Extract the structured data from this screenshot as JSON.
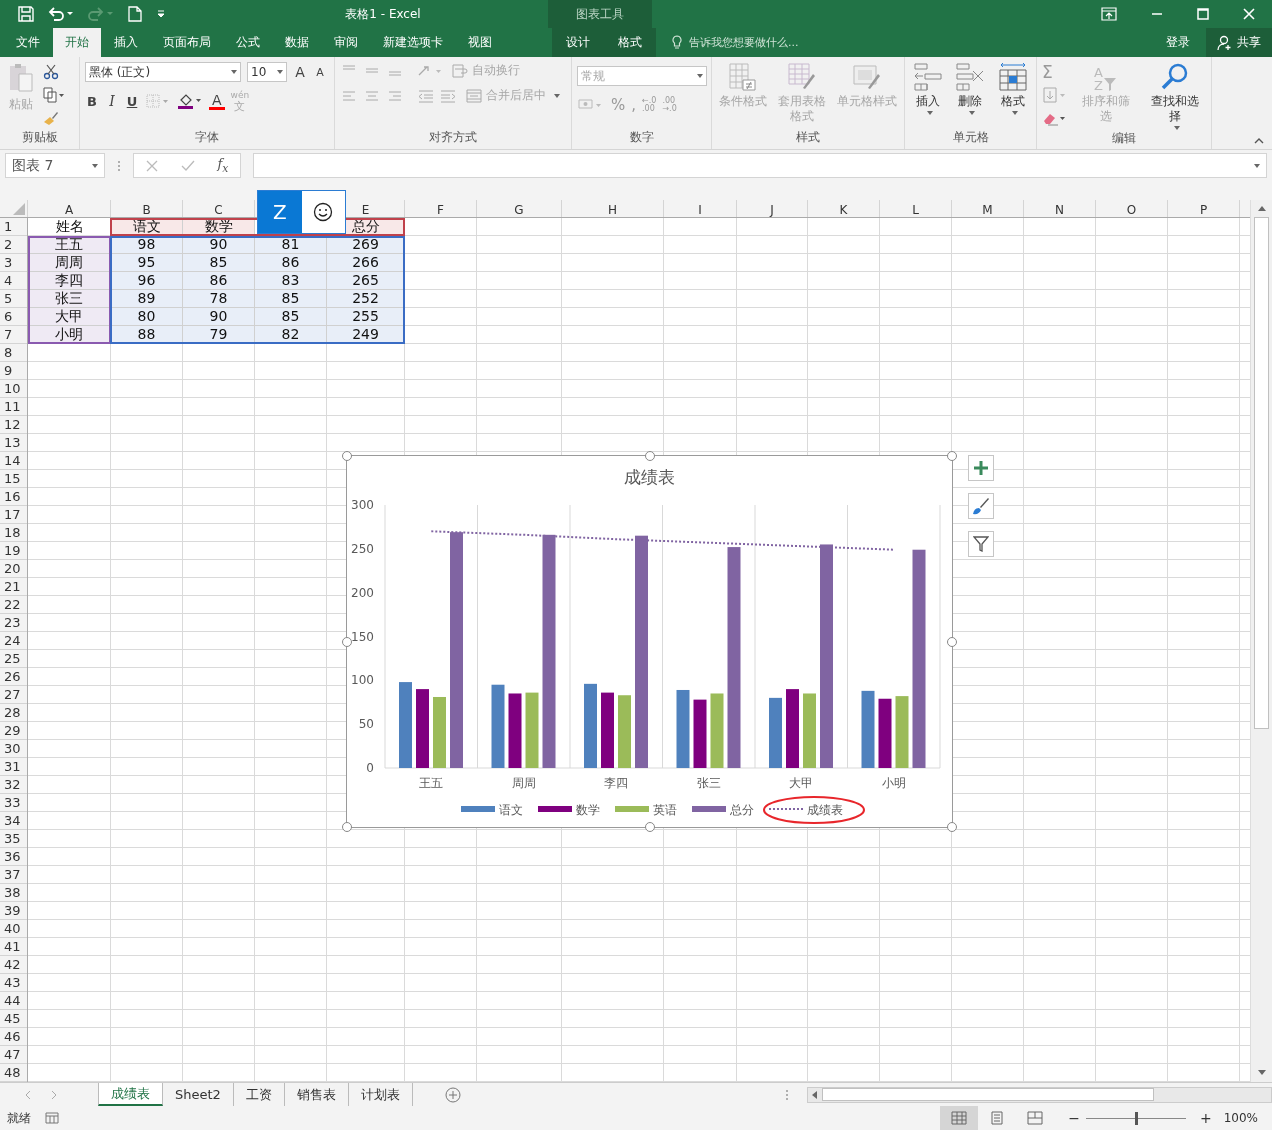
{
  "title_bar": {
    "title": "表格1 - Excel",
    "context_title": "图表工具"
  },
  "menu_tabs": [
    {
      "label": "文件",
      "selected": false,
      "context": false
    },
    {
      "label": "开始",
      "selected": true,
      "context": false
    },
    {
      "label": "插入",
      "selected": false,
      "context": false
    },
    {
      "label": "页面布局",
      "selected": false,
      "context": false
    },
    {
      "label": "公式",
      "selected": false,
      "context": false
    },
    {
      "label": "数据",
      "selected": false,
      "context": false
    },
    {
      "label": "审阅",
      "selected": false,
      "context": false
    },
    {
      "label": "新建选项卡",
      "selected": false,
      "context": false
    },
    {
      "label": "视图",
      "selected": false,
      "context": false
    },
    {
      "label": "设计",
      "selected": false,
      "context": true
    },
    {
      "label": "格式",
      "selected": false,
      "context": true
    }
  ],
  "tell_me": {
    "placeholder": "告诉我您想要做什么..."
  },
  "account": {
    "sign_in": "登录",
    "share": "共享"
  },
  "ribbon": {
    "clipboard": {
      "label": "剪贴板",
      "paste": {
        "label": "粘贴",
        "disabled": true
      }
    },
    "font": {
      "label": "字体",
      "font_name": "黑体 (正文)",
      "font_size": "10",
      "grow": "A",
      "shrink": "A",
      "bold": "B",
      "italic": "I",
      "underline": "U",
      "font_color": "A",
      "phonetic_top": "wén",
      "phonetic_bottom": "文"
    },
    "alignment": {
      "label": "对齐方式",
      "wrap_text": {
        "label": "自动换行",
        "disabled": true
      },
      "merge": {
        "label": "合并后居中",
        "disabled": true
      }
    },
    "number": {
      "label": "数字",
      "format": "常规",
      "percent": "%",
      "comma": ",",
      "increase_decimal": [
        "←.0",
        ".00"
      ],
      "decrease_decimal": [
        ".00",
        "→.0"
      ]
    },
    "styles": {
      "label": "样式",
      "buttons": [
        {
          "label": "条件格式",
          "disabled": true,
          "kind": "conditional"
        },
        {
          "label": "套用表格格式",
          "disabled": true,
          "kind": "table"
        },
        {
          "label": "单元格样式",
          "disabled": true,
          "kind": "cellstyle"
        }
      ]
    },
    "cells": {
      "label": "单元格",
      "buttons": [
        {
          "label": "插入",
          "disabled": false,
          "kind": "insert"
        },
        {
          "label": "删除",
          "disabled": false,
          "kind": "delete"
        },
        {
          "label": "格式",
          "disabled": false,
          "kind": "format"
        }
      ]
    },
    "editing": {
      "label": "编辑",
      "autosum": "Σ",
      "sort": {
        "label": "排序和筛选",
        "disabled": true,
        "letters": [
          "A",
          "Z"
        ]
      },
      "find": {
        "label": "查找和选择",
        "disabled": false
      }
    }
  },
  "formula_bar": {
    "name_box": "图表 7",
    "fx": "f$_{x}$"
  },
  "ime_bar": {
    "mode": "Z"
  },
  "sheet": {
    "columns": [
      "A",
      "B",
      "C",
      null,
      "E",
      "F",
      "G",
      "H",
      "I",
      "J",
      "K",
      "L",
      "M",
      "N",
      "O",
      "P"
    ],
    "row_numbers": [
      "1",
      "2",
      "3",
      "4",
      "5",
      "6",
      "7",
      "8",
      "9",
      "10",
      "11",
      "12",
      "13",
      "14",
      "15",
      "16",
      "17",
      "18",
      "19",
      "20",
      "21",
      "22",
      "23",
      "24",
      "25",
      "26",
      "27",
      "28",
      "29",
      "30",
      "31",
      "32",
      "33",
      "34",
      "35",
      "36",
      "37",
      "38",
      "39",
      "40",
      "41",
      "42",
      "43",
      "44",
      "45",
      "46",
      "47",
      "48"
    ],
    "rows": [
      [
        "姓名",
        "语文",
        "数学",
        null,
        "总分"
      ],
      [
        "王五",
        "98",
        "90",
        "81",
        "269"
      ],
      [
        "周周",
        "95",
        "85",
        "86",
        "266"
      ],
      [
        "李四",
        "96",
        "86",
        "83",
        "265"
      ],
      [
        "张三",
        "89",
        "78",
        "85",
        "252"
      ],
      [
        "大甲",
        "80",
        "90",
        "85",
        "255"
      ],
      [
        "小明",
        "88",
        "79",
        "82",
        "249"
      ]
    ]
  },
  "chart": {
    "chart_data": {
      "type": "bar",
      "title": "成绩表",
      "categories": [
        "王五",
        "周周",
        "李四",
        "张三",
        "大甲",
        "小明"
      ],
      "series": [
        {
          "name": "语文",
          "color": "#4f81bd",
          "type": "bar",
          "values": [
            98,
            95,
            96,
            89,
            80,
            88
          ]
        },
        {
          "name": "数学",
          "color": "#7f007f",
          "type": "bar",
          "values": [
            90,
            85,
            86,
            78,
            90,
            79
          ]
        },
        {
          "name": "英语",
          "color": "#9bbb59",
          "type": "bar",
          "values": [
            81,
            86,
            83,
            85,
            85,
            82
          ]
        },
        {
          "name": "总分",
          "color": "#8064a2",
          "type": "bar",
          "values": [
            269,
            266,
            265,
            252,
            255,
            249
          ]
        },
        {
          "name": "成绩表",
          "color": "#8064a2",
          "type": "line",
          "line_style": "dotted",
          "values": [
            270,
            266,
            261,
            257,
            253,
            249
          ]
        }
      ],
      "legend": "bottom",
      "stacked": false,
      "ylim": [
        0,
        300
      ],
      "yticks": [
        0,
        50,
        100,
        150,
        200,
        250,
        300
      ]
    },
    "legend": [
      {
        "circled": false
      },
      {
        "circled": false
      },
      {
        "circled": false
      },
      {
        "circled": false
      },
      {
        "circled": true
      }
    ]
  },
  "sheet_tabs": [
    {
      "label": "成绩表",
      "selected": true
    },
    {
      "label": "Sheet2",
      "selected": false
    },
    {
      "label": "工资",
      "selected": false
    },
    {
      "label": "销售表",
      "selected": false
    },
    {
      "label": "计划表",
      "selected": false
    }
  ],
  "status_bar": {
    "status": "就绪",
    "views": [
      {
        "kind": "normal",
        "selected": true
      },
      {
        "kind": "page_layout",
        "selected": false
      },
      {
        "kind": "page_break",
        "selected": false
      }
    ],
    "zoom_out": "−",
    "zoom_in": "+",
    "zoom": {
      "level": 0.5,
      "reading": "100%"
    }
  }
}
